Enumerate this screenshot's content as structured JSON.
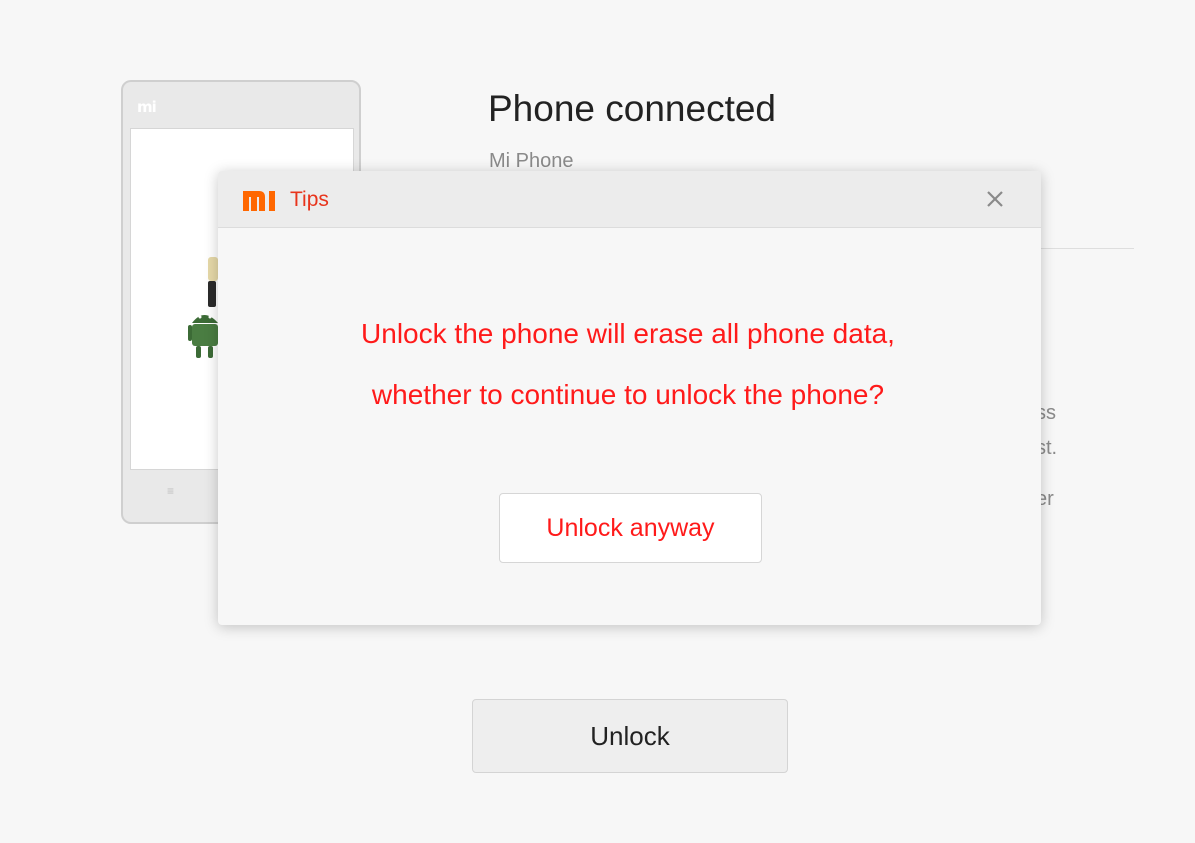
{
  "phone": {
    "logo_text": "mi",
    "menu_key": "≡"
  },
  "info": {
    "title": "Phone connected",
    "device": "Mi Phone",
    "partial_line_1": "ss",
    "partial_line_2": "st.",
    "partial_line_3": "er"
  },
  "main": {
    "unlock_label": "Unlock"
  },
  "dialog": {
    "title": "Tips",
    "message": "Unlock the phone will erase all phone data, whether to continue to unlock the phone?",
    "action_label": "Unlock anyway",
    "close_glyph": "×"
  },
  "colors": {
    "accent": "#e8341c",
    "warning_text": "#ff1a1a",
    "background": "#f7f7f7"
  },
  "icons": {
    "dialog_logo": "mi-logo-icon",
    "close": "close-icon",
    "android": "android-icon"
  }
}
